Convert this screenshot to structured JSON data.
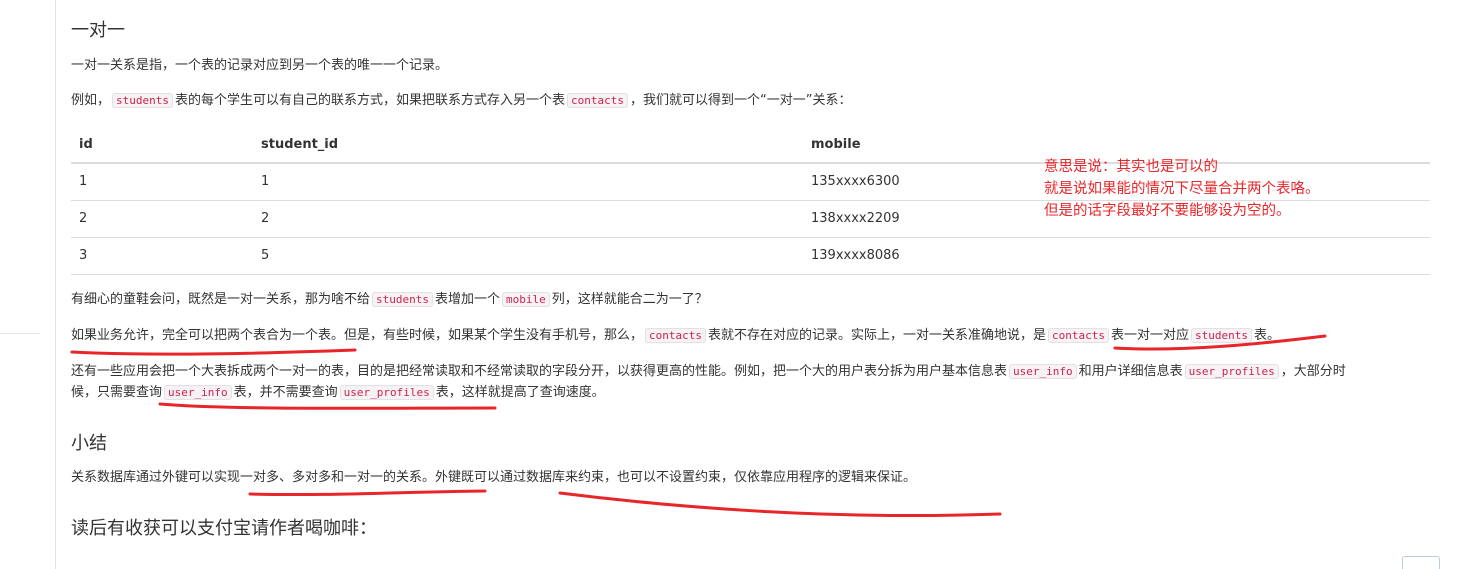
{
  "doc": {
    "title_one_to_one": "一对一",
    "p1": "一对一关系是指，一个表的记录对应到另一个表的唯一一个记录。",
    "p2_a": "例如，",
    "p2_code1": "students",
    "p2_b": "表的每个学生可以有自己的联系方式，如果把联系方式存入另一个表",
    "p2_code2": "contacts",
    "p2_c": "，我们就可以得到一个“一对一”关系：",
    "table": {
      "headers": [
        "id",
        "student_id",
        "mobile"
      ],
      "rows": [
        [
          "1",
          "1",
          "135xxxx6300"
        ],
        [
          "2",
          "2",
          "138xxxx2209"
        ],
        [
          "3",
          "5",
          "139xxxx8086"
        ]
      ]
    },
    "p3_a": "有细心的童鞋会问，既然是一对一关系，那为啥不给",
    "p3_code1": "students",
    "p3_b": "表增加一个",
    "p3_code2": "mobile",
    "p3_c": "列，这样就能合二为一了？",
    "p4_a": "如果业务允许，完全可以把两个表合为一个表。但是，有些时候，如果某个学生没有手机号，那么，",
    "p4_code1": "contacts",
    "p4_b": "表就不存在对应的记录。实际上，一对一关系准确地说，是",
    "p4_code2": "contacts",
    "p4_c": "表一对一对应",
    "p4_code3": "students",
    "p4_d": "表。",
    "p5_l1_a": "还有一些应用会把一个大表拆成两个一对一的表，目的是把经常读取和不经常读取的字段分开，以获得更高的性能。例如，把一个大的用户表分拆为用户基本信息表",
    "p5_code1": "user_info",
    "p5_l1_b": "和用户详细信息表",
    "p5_code2": "user_profiles",
    "p5_l1_c": "，大部分时",
    "p5_l2_a": "候，只需要查询",
    "p5_code3": "user_info",
    "p5_l2_b": "表，并不需要查询",
    "p5_code4": "user_profiles",
    "p5_l2_c": "表，这样就提高了查询速度。",
    "title_summary": "小结",
    "p6": "关系数据库通过外键可以实现一对多、多对多和一对一的关系。外键既可以通过数据库来约束，也可以不设置约束，仅依靠应用程序的逻辑来保证。",
    "title_coffee": "读后有收获可以支付宝请作者喝咖啡："
  },
  "annotation": {
    "line1": "意思是说：其实也是可以的",
    "line2": "就是说如果能的情况下尽量合并两个表咯。",
    "line3": "但是的话字段最好不要能够设为空的。"
  },
  "colors": {
    "annotation": "#e8262a",
    "code": "#c7254e"
  }
}
